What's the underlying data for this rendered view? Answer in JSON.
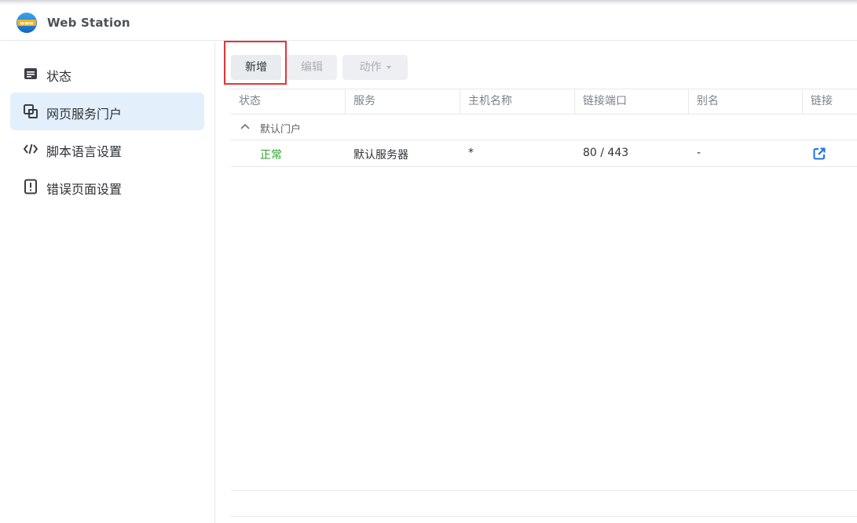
{
  "app": {
    "title": "Web Station",
    "logo_icon": "web-station-logo-icon"
  },
  "sidebar": {
    "items": [
      {
        "label": "状态",
        "icon": "status-icon",
        "active": false
      },
      {
        "label": "网页服务门户",
        "icon": "web-portal-icon",
        "active": true
      },
      {
        "label": "脚本语言设置",
        "icon": "code-icon",
        "active": false
      },
      {
        "label": "错误页面设置",
        "icon": "error-page-icon",
        "active": false
      }
    ]
  },
  "toolbar": {
    "create_label": "新增",
    "edit_label": "编辑",
    "action_label": "动作"
  },
  "table": {
    "columns": [
      "状态",
      "服务",
      "主机名称",
      "链接端口",
      "别名",
      "链接"
    ],
    "group": {
      "label": "默认门户",
      "expanded": true
    },
    "rows": [
      {
        "status": "正常",
        "service": "默认服务器",
        "hostname": "*",
        "port": "80 / 443",
        "alias": "-",
        "link_icon": "external-link-icon"
      }
    ]
  },
  "colors": {
    "accent": "#1a73e8",
    "active_bg": "#e3effb",
    "status_ok": "#2ba12b",
    "highlight": "#e53535"
  }
}
